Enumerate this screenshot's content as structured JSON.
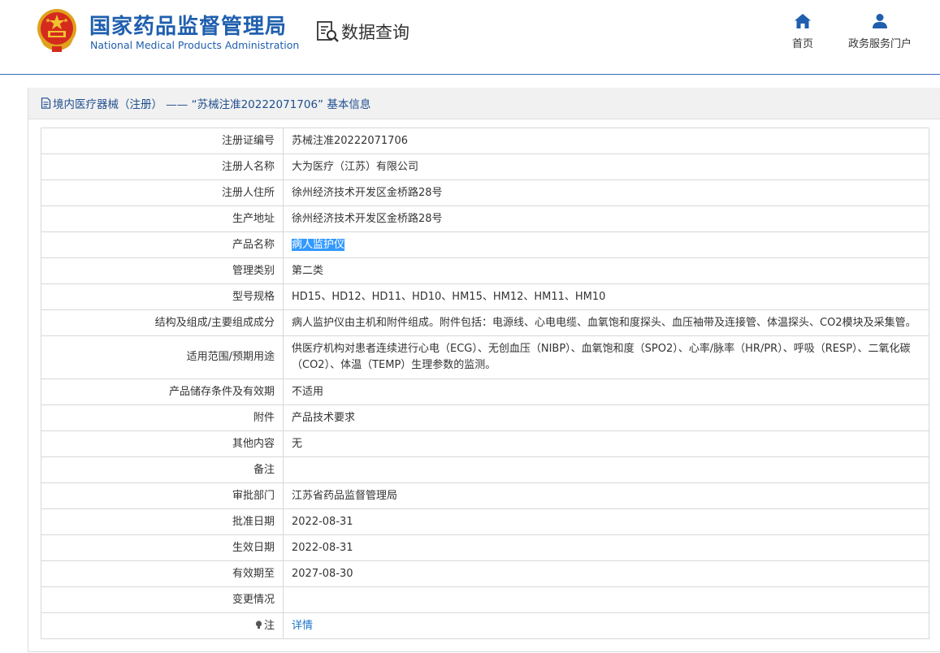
{
  "header": {
    "brand_cn": "国家药品监督管理局",
    "brand_en": "National Medical Products Administration",
    "search_title": "数据查询",
    "nav": [
      {
        "label": "首页",
        "icon": "home-icon"
      },
      {
        "label": "政务服务门户",
        "icon": "user-icon"
      }
    ]
  },
  "panel": {
    "title": "境内医疗器械（注册） ——  “苏械注准20222071706”  基本信息"
  },
  "rows": [
    {
      "label": "注册证编号",
      "value": "苏械注准20222071706"
    },
    {
      "label": "注册人名称",
      "value": "大为医疗（江苏）有限公司"
    },
    {
      "label": "注册人住所",
      "value": "徐州经济技术开发区金桥路28号"
    },
    {
      "label": "生产地址",
      "value": "徐州经济技术开发区金桥路28号"
    },
    {
      "label": "产品名称",
      "value": "病人监护仪"
    },
    {
      "label": "管理类别",
      "value": "第二类"
    },
    {
      "label": "型号规格",
      "value": "HD15、HD12、HD11、HD10、HM15、HM12、HM11、HM10"
    },
    {
      "label": "结构及组成/主要组成成分",
      "value": "病人监护仪由主机和附件组成。附件包括：电源线、心电电缆、血氧饱和度探头、血压袖带及连接管、体温探头、CO2模块及采集管。"
    },
    {
      "label": "适用范围/预期用途",
      "value": "供医疗机构对患者连续进行心电（ECG）、无创血压（NIBP）、血氧饱和度（SPO2）、心率/脉率（HR/PR）、呼吸（RESP）、二氧化碳（CO2）、体温（TEMP）生理参数的监测。"
    },
    {
      "label": "产品储存条件及有效期",
      "value": "不适用"
    },
    {
      "label": "附件",
      "value": "产品技术要求"
    },
    {
      "label": "其他内容",
      "value": "无"
    },
    {
      "label": "备注",
      "value": ""
    },
    {
      "label": "审批部门",
      "value": "江苏省药品监督管理局"
    },
    {
      "label": "批准日期",
      "value": "2022-08-31"
    },
    {
      "label": "生效日期",
      "value": "2022-08-31"
    },
    {
      "label": "有效期至",
      "value": "2027-08-30"
    },
    {
      "label": "变更情况",
      "value": ""
    },
    {
      "label": "注",
      "value": "详情",
      "icon": "lightbulb-icon"
    }
  ],
  "colors": {
    "brand_blue": "#1f5fae",
    "link_blue": "#1a73c9",
    "selection": "#3399ff",
    "border": "#d8d8d8",
    "panel_head_bg": "#f1f1f1"
  }
}
